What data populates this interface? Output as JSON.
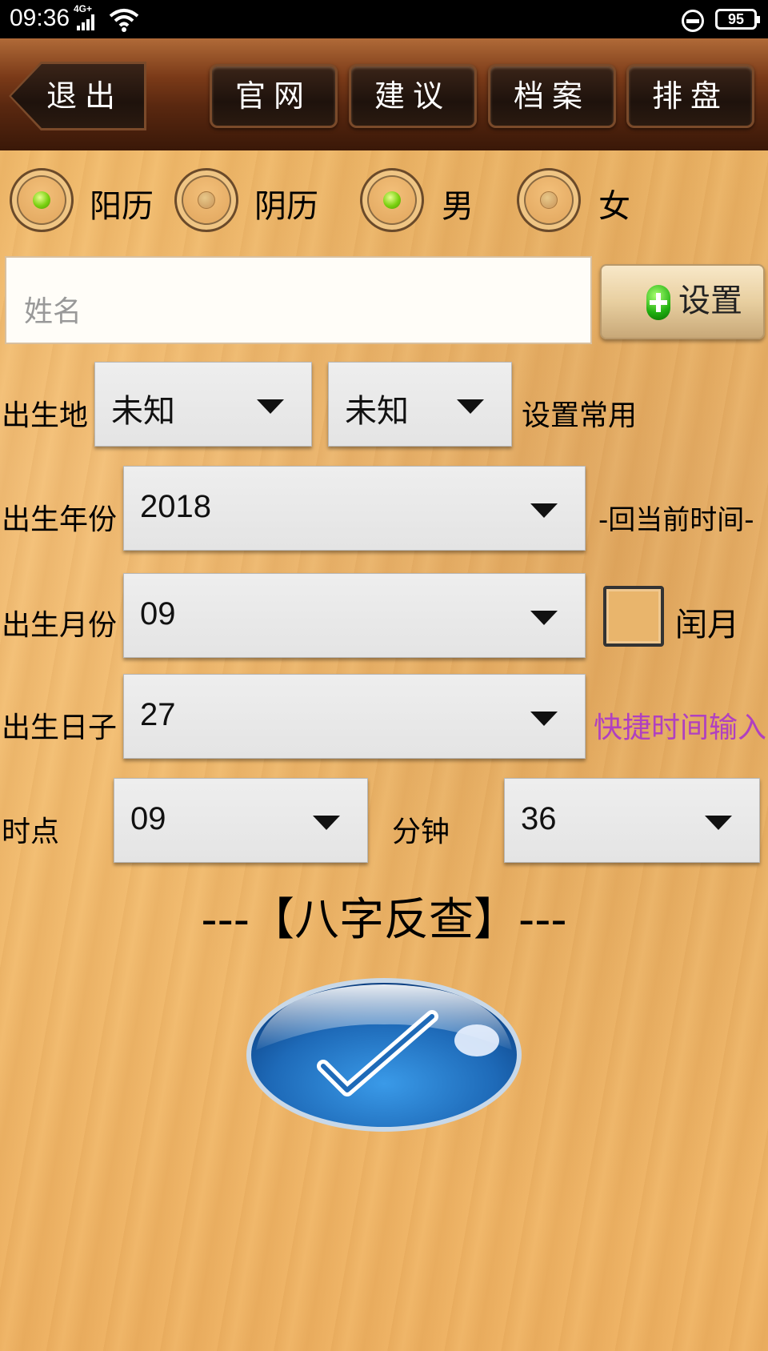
{
  "status_bar": {
    "time": "09:36",
    "network": "4G+",
    "battery": "95"
  },
  "toolbar": {
    "back_label": "退出",
    "buttons": [
      {
        "label": "官网"
      },
      {
        "label": "建议"
      },
      {
        "label": "档案"
      },
      {
        "label": "排盘"
      }
    ]
  },
  "calendar_options": [
    {
      "label": "阳历",
      "selected": true
    },
    {
      "label": "阴历",
      "selected": false
    }
  ],
  "gender_options": [
    {
      "label": "男",
      "selected": true
    },
    {
      "label": "女",
      "selected": false
    }
  ],
  "name_field": {
    "placeholder": "姓名"
  },
  "set_button": {
    "label": "设置"
  },
  "birthplace": {
    "label": "出生地",
    "province": "未知",
    "city": "未知",
    "set_common": "设置常用"
  },
  "year": {
    "label": "出生年份",
    "value": "2018",
    "back_to_now": "-回当前时间-"
  },
  "month": {
    "label": "出生月份",
    "value": "09",
    "leap_label": "闰月",
    "leap_checked": false
  },
  "day": {
    "label": "出生日子",
    "value": "27",
    "quick_input": "快捷时间输入"
  },
  "hour": {
    "label": "时点",
    "value": "09"
  },
  "minute": {
    "label": "分钟",
    "value": "36"
  },
  "bazi_lookup": "---【八字反查】---",
  "colors": {
    "toolbar": "#5a2810",
    "background": "#f2bd72",
    "radio_selected": "#7ad010",
    "link": "#b040c0",
    "confirm_button": "#1e6ab8"
  }
}
